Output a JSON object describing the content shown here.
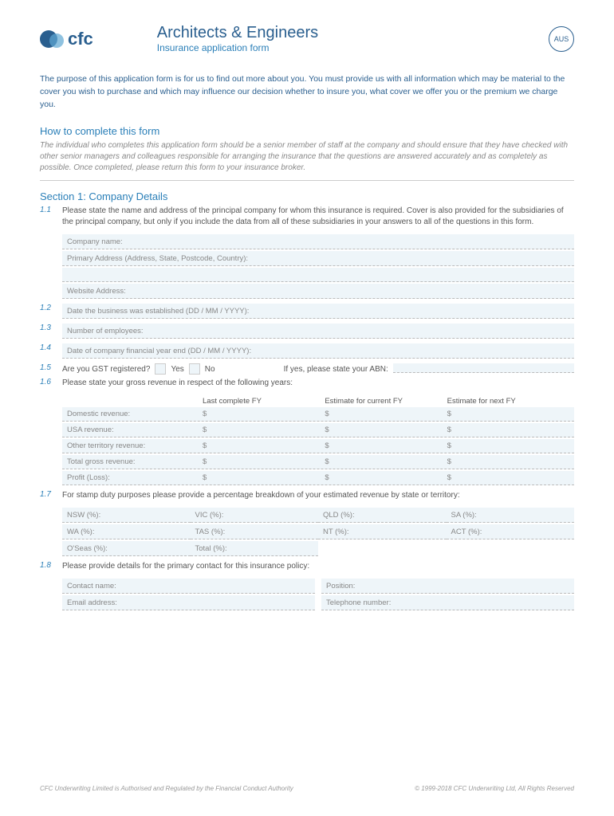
{
  "header": {
    "logo_text": "cfc",
    "title": "Architects & Engineers",
    "subtitle": "Insurance application form",
    "badge": "AUS"
  },
  "intro": "The purpose of this application form is for us to find out more about you. You must provide us with all information which may be material to the cover you wish to purchase and which may influence our decision whether to insure you, what cover we offer you or the premium we charge you.",
  "howto_heading": "How to complete this form",
  "howto_text": "The individual who completes this application form should be a senior member of staff at the company and should ensure that they have checked with other senior managers and colleagues responsible for arranging the insurance that the questions are answered accurately and as completely as possible. Once completed, please return this form to your insurance broker.",
  "section1_heading": "Section 1: Company Details",
  "q11": {
    "num": "1.1",
    "text": "Please state the name and address of the principal company for whom this insurance is required. Cover is also provided for the subsidiaries of the principal company, but only if you include the data from all of these subsidiaries in your answers to all of the questions in this form.",
    "company": "Company name:",
    "address": "Primary Address (Address, State, Postcode, Country):",
    "website": "Website Address:"
  },
  "q12": {
    "num": "1.2",
    "text": "Date the business was established (DD / MM / YYYY):"
  },
  "q13": {
    "num": "1.3",
    "text": "Number of employees:"
  },
  "q14": {
    "num": "1.4",
    "text": "Date of company financial year end (DD / MM / YYYY):"
  },
  "q15": {
    "num": "1.5",
    "text": "Are you GST registered?",
    "yes": "Yes",
    "no": "No",
    "abn": "If yes, please state your ABN:"
  },
  "q16": {
    "num": "1.6",
    "text": "Please state your gross revenue in respect of the following years:",
    "h1": "Last complete FY",
    "h2": "Estimate for current FY",
    "h3": "Estimate for next FY",
    "rows": [
      "Domestic revenue:",
      "USA revenue:",
      "Other territory revenue:",
      "Total gross revenue:",
      "Profit (Loss):"
    ],
    "sym": "$"
  },
  "q17": {
    "num": "1.7",
    "text": "For stamp duty purposes please provide a percentage breakdown of your estimated revenue by state or territory:",
    "states": [
      "NSW (%):",
      "VIC (%):",
      "QLD (%):",
      "SA (%):",
      "WA (%):",
      "TAS (%):",
      "NT (%):",
      "ACT (%):",
      "O'Seas (%):",
      "Total (%):"
    ]
  },
  "q18": {
    "num": "1.8",
    "text": "Please provide details for the primary contact for this insurance policy:",
    "contact": "Contact name:",
    "position": "Position:",
    "email": "Email address:",
    "phone": "Telephone number:"
  },
  "footer": {
    "left": "CFC Underwriting Limited is Authorised and Regulated by the Financial Conduct Authority",
    "right": "© 1999-2018 CFC Underwriting Ltd, All Rights Reserved"
  }
}
